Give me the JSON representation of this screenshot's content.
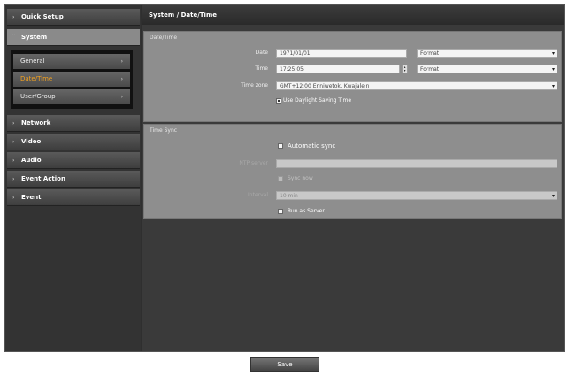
{
  "sidebar": {
    "items": [
      {
        "label": "Quick Setup"
      },
      {
        "label": "System"
      },
      {
        "label": "Network"
      },
      {
        "label": "Video"
      },
      {
        "label": "Audio"
      },
      {
        "label": "Event Action"
      },
      {
        "label": "Event"
      }
    ],
    "submenu": [
      {
        "label": "General"
      },
      {
        "label": "Date/Time"
      },
      {
        "label": "User/Group"
      }
    ]
  },
  "header": {
    "title": "System / Date/Time"
  },
  "datetime": {
    "section_title": "Date/Time",
    "date_label": "Date",
    "date_value": "1971/01/01",
    "date_format": "Format",
    "time_label": "Time",
    "time_value": "17:25:05",
    "time_format": "Format",
    "timezone_label": "Time zone",
    "timezone_value": "GMT+12:00 Enniwetok, Kwajalein",
    "dst_label": "Use Daylight Saving Time"
  },
  "timesync": {
    "section_title": "Time Sync",
    "auto_sync_label": "Automatic sync",
    "ntp_server_label": "NTP server",
    "ntp_server_value": "",
    "sync_option_label": "Sync now",
    "interval_label": "Interval",
    "interval_value": "10 min",
    "run_server_label": "Run as Server"
  },
  "footer": {
    "save_label": "Save"
  },
  "colors": {
    "accent": "#f0a020",
    "panel": "#8e8e8e",
    "background": "#2f2f2f"
  }
}
